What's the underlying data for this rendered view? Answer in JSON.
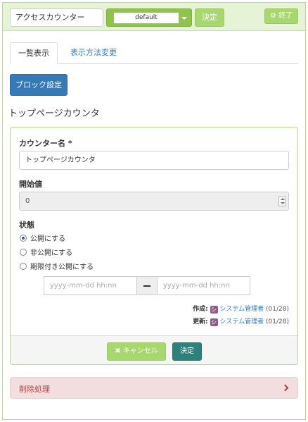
{
  "header": {
    "frame_name": "アクセスカウンター",
    "theme_value": "default",
    "decide_label": "決定",
    "close_label": "終了"
  },
  "tabs": [
    {
      "label": "一覧表示",
      "active": true
    },
    {
      "label": "表示方法変更",
      "active": false
    }
  ],
  "block_settings_label": "ブロック設定",
  "page_title": "トップページカウンタ",
  "form": {
    "counter_name_label": "カウンター名",
    "required_mark": "*",
    "counter_name_value": "トップページカウンタ",
    "start_value_label": "開始値",
    "start_value": "0",
    "status_label": "状態",
    "status_options": [
      {
        "label": "公開にする",
        "selected": true
      },
      {
        "label": "非公開にする",
        "selected": false
      },
      {
        "label": "期限付き公開にする",
        "selected": false
      }
    ],
    "date_from_placeholder": "yyyy-mm-dd hh:nn",
    "date_to_placeholder": "yyyy-mm-dd hh:nn",
    "created_label": "作成:",
    "updated_label": "更新:",
    "user_icon_glyph": "シ",
    "created_user": "システム管理者",
    "created_date": "(01/28)",
    "updated_user": "システム管理者",
    "updated_date": "(01/28)",
    "cancel_label": "キャンセル",
    "submit_label": "決定"
  },
  "delete_label": "削除処理",
  "colors": {
    "accent_green": "#a8d76f",
    "primary_blue": "#337ab7",
    "submit_teal": "#2f7f7a",
    "danger_bg": "#f2dede"
  }
}
